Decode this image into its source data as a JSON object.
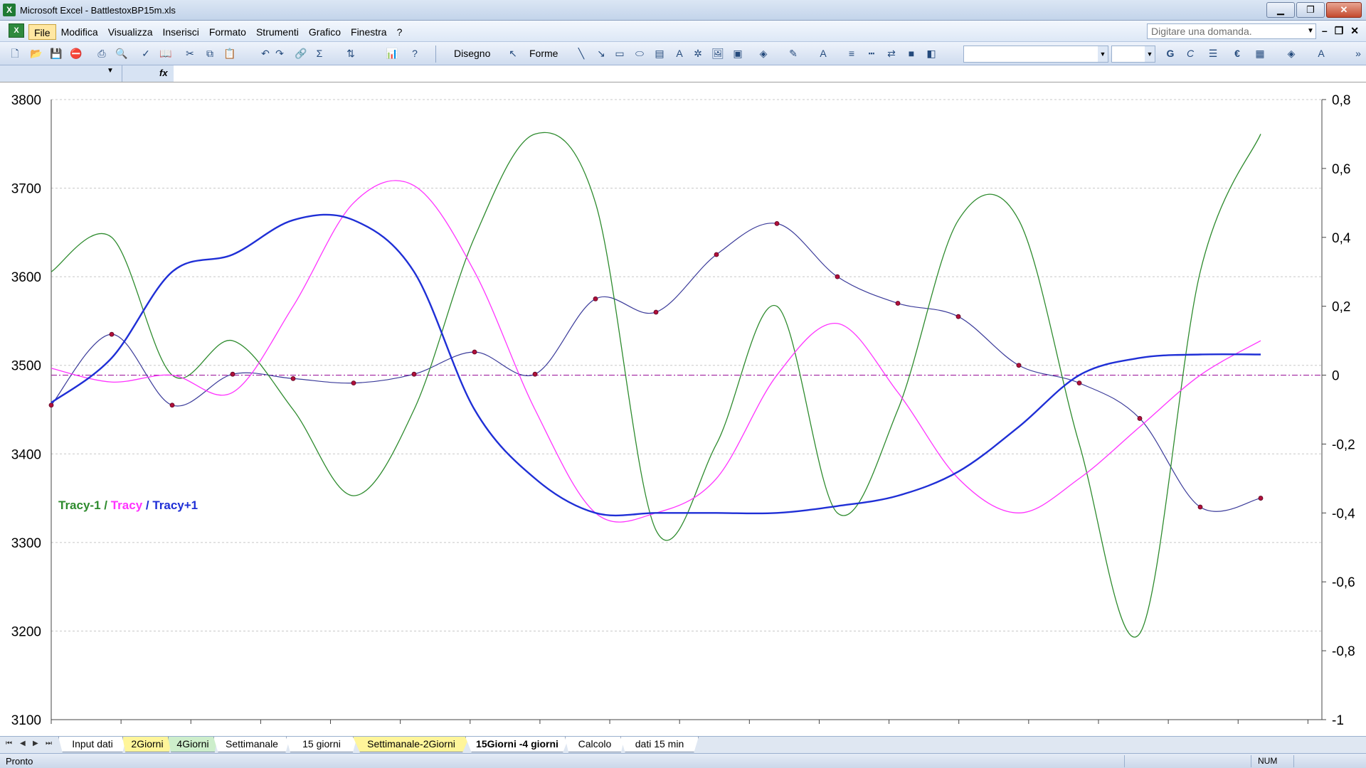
{
  "window": {
    "title": "Microsoft Excel - BattlestoxBP15m.xls",
    "app_icon": "excel-icon"
  },
  "menu": {
    "items": [
      "File",
      "Modifica",
      "Visualizza",
      "Inserisci",
      "Formato",
      "Strumenti",
      "Grafico",
      "Finestra",
      "?"
    ],
    "ask_placeholder": "Digitare una domanda."
  },
  "toolbar": {
    "draw_label": "Disegno",
    "shapes_label": "Forme",
    "bold": "G",
    "italic": "C",
    "euro": "€"
  },
  "chart": {
    "legend": {
      "a": "Tracy-1",
      "sep1": " / ",
      "b": "Tracy",
      "sep2": " / ",
      "c": "Tracy+1"
    },
    "colors": {
      "price": "#b0103a",
      "tracy_minus1": "#2e8b2e",
      "tracy": "#ff33ff",
      "tracy_plus1": "#1f2fd6",
      "zero": "#a020a0"
    },
    "left_ticks": [
      "3800",
      "3700",
      "3600",
      "3500",
      "3400",
      "3300",
      "3200",
      "3100"
    ],
    "right_ticks": [
      "0,8",
      "0,6",
      "0,4",
      "0,2",
      "0",
      "-0,2",
      "-0,4",
      "-0,6",
      "-0,8",
      "-1"
    ]
  },
  "chart_data": {
    "type": "line",
    "title": "",
    "xlabel": "",
    "ylabel": "",
    "ylim": [
      3100,
      3800
    ],
    "y2lim": [
      -1,
      0.8
    ],
    "grid": true,
    "x": [
      0,
      5,
      10,
      15,
      20,
      25,
      30,
      35,
      40,
      45,
      50,
      55,
      60,
      65,
      70,
      75,
      80,
      85,
      90,
      95,
      100
    ],
    "series": [
      {
        "name": "",
        "axis": "left",
        "values": [
          3455,
          3535,
          3455,
          3490,
          3485,
          3480,
          3490,
          3515,
          3490,
          3575,
          3560,
          3625,
          3660,
          3600,
          3570,
          3555,
          3500,
          3480,
          3440,
          3340,
          3350
        ]
      },
      {
        "name": "Tracy-1",
        "axis": "right",
        "values": [
          0.3,
          0.4,
          0.0,
          0.1,
          -0.1,
          -0.35,
          -0.1,
          0.4,
          0.7,
          0.5,
          -0.45,
          -0.2,
          0.2,
          -0.4,
          -0.1,
          0.45,
          0.45,
          -0.2,
          -0.75,
          0.3,
          0.7
        ]
      },
      {
        "name": "Tracy",
        "axis": "right",
        "values": [
          0.02,
          -0.02,
          0.0,
          -0.05,
          0.2,
          0.5,
          0.55,
          0.3,
          -0.1,
          -0.4,
          -0.4,
          -0.3,
          0.0,
          0.15,
          -0.05,
          -0.3,
          -0.4,
          -0.3,
          -0.15,
          0.0,
          0.1
        ]
      },
      {
        "name": "Tracy+1",
        "axis": "right",
        "values": [
          -0.08,
          0.05,
          0.3,
          0.35,
          0.45,
          0.45,
          0.3,
          -0.1,
          -0.3,
          -0.4,
          -0.4,
          -0.4,
          -0.4,
          -0.38,
          -0.35,
          -0.28,
          -0.15,
          0.0,
          0.05,
          0.06,
          0.06
        ]
      }
    ]
  },
  "sheets": {
    "tabs": [
      "Input dati",
      "2Giorni",
      "4Giorni",
      "Settimanale",
      "15 giorni",
      "Settimanale-2Giorni",
      "15Giorni -4 giorni",
      "Calcolo",
      "dati 15 min"
    ],
    "active": "15Giorni -4 giorni"
  },
  "status": {
    "text": "Pronto",
    "num": "NUM"
  }
}
